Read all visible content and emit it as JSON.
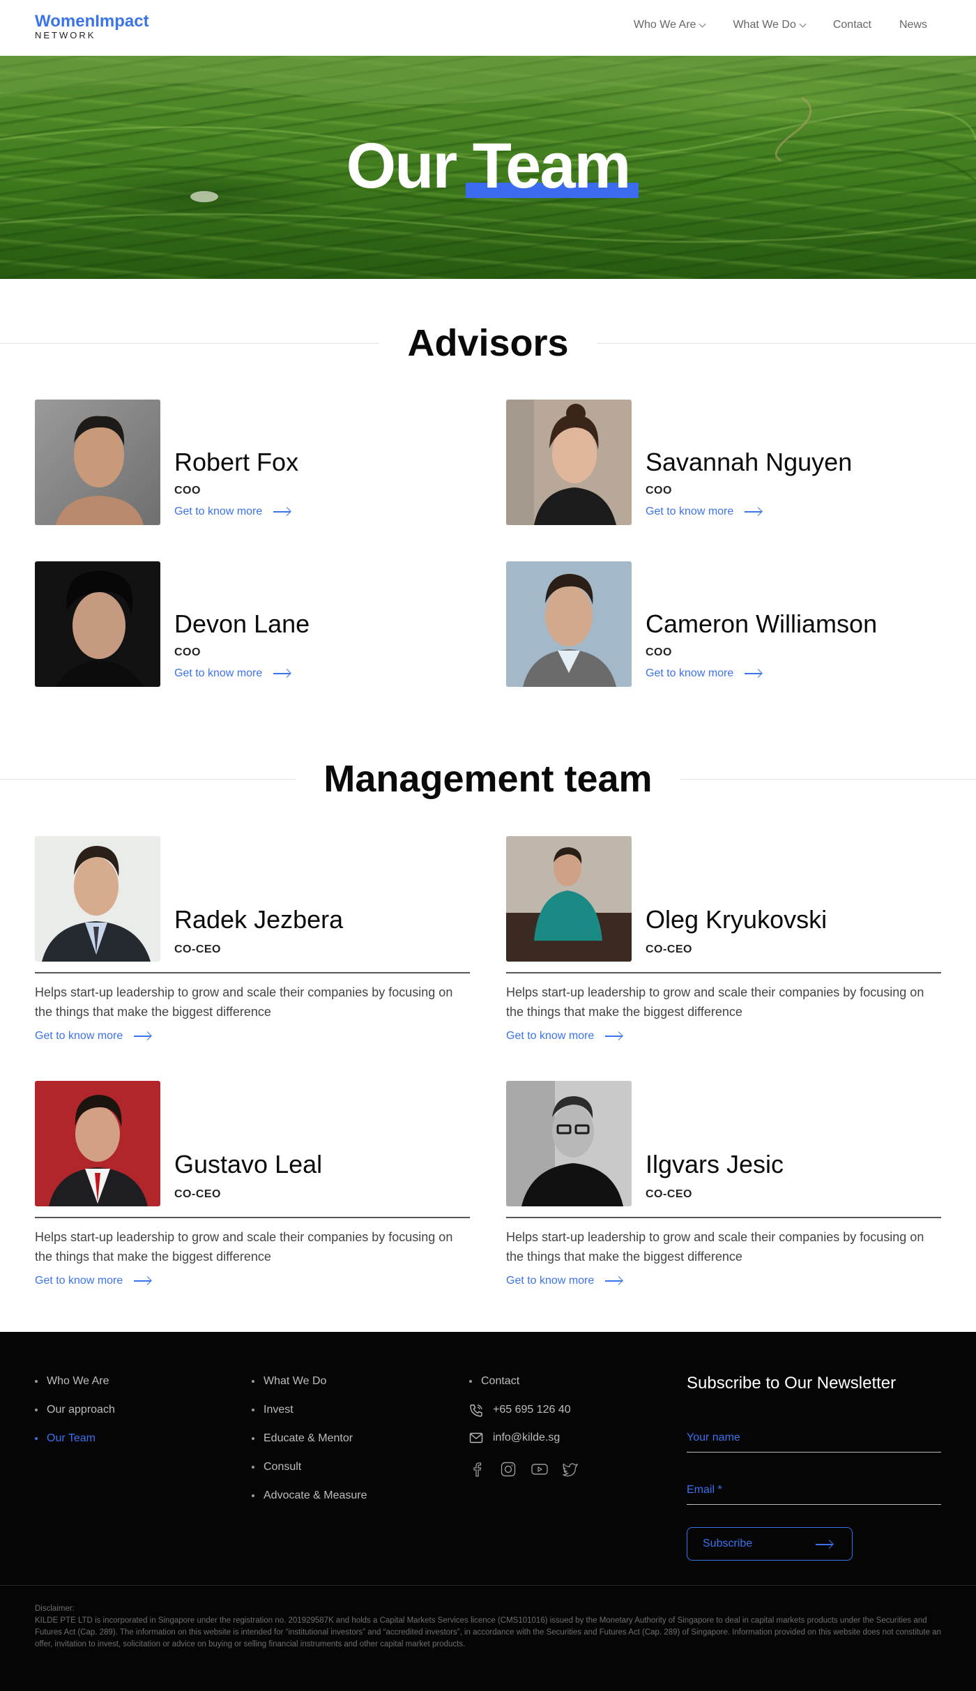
{
  "header": {
    "logo_top": "WomenImpact",
    "logo_bottom": "NETWORK",
    "nav": [
      {
        "label": "Who We Are",
        "dropdown": true
      },
      {
        "label": "What We Do",
        "dropdown": true
      },
      {
        "label": "Contact",
        "dropdown": false
      },
      {
        "label": "News",
        "dropdown": false
      }
    ]
  },
  "hero": {
    "title_part1": "Our",
    "title_part2": "Team"
  },
  "advisors": {
    "title": "Advisors",
    "people": [
      {
        "name": "Robert Fox",
        "role": "COO",
        "link": "Get to know more"
      },
      {
        "name": "Savannah Nguyen",
        "role": "COO",
        "link": "Get to know more"
      },
      {
        "name": "Devon Lane",
        "role": "COO",
        "link": "Get to know more"
      },
      {
        "name": "Cameron Williamson",
        "role": "COO",
        "link": "Get to know more"
      }
    ]
  },
  "management": {
    "title": "Management team",
    "people": [
      {
        "name": "Radek Jezbera",
        "role": "CO-CEO",
        "description": "Helps start-up leadership to grow and scale their companies by focusing on the things that make the biggest difference",
        "link": "Get to know more"
      },
      {
        "name": "Oleg Kryukovski",
        "role": "CO-CEO",
        "description": "Helps start-up leadership to grow and scale their companies by focusing on the things that make the biggest difference",
        "link": "Get to know more"
      },
      {
        "name": "Gustavo Leal",
        "role": "CO-CEO",
        "description": "Helps start-up leadership to grow and scale their companies by focusing on the things that make the biggest difference",
        "link": "Get to know more"
      },
      {
        "name": "Ilgvars Jesic",
        "role": "CO-CEO",
        "description": "Helps start-up leadership to grow and scale their companies by focusing on the things that make the biggest difference",
        "link": "Get to know more"
      }
    ]
  },
  "footer": {
    "col1": [
      "Who We Are",
      "Our approach",
      "Our Team"
    ],
    "col2": [
      "What We Do",
      "Invest",
      "Educate & Mentor",
      "Consult",
      "Advocate & Measure"
    ],
    "contact_label": "Contact",
    "phone": "+65 695 126 40",
    "email": "info@kilde.sg",
    "socials": [
      "facebook-icon",
      "instagram-icon",
      "youtube-icon",
      "twitter-icon"
    ],
    "newsletter": {
      "title": "Subscribe to Our Newsletter",
      "name_placeholder": "Your name",
      "email_placeholder": "Email *",
      "button": "Subscribe"
    },
    "disclaimer_label": "Disclaimer:",
    "disclaimer_text": "KILDE PTE LTD is incorporated in Singapore under the registration no. 201929587K and holds a Capital Markets Services licence (CMS101016) issued by the Monetary Authority of Singapore to deal in capital markets products under the Securities and Futures Act (Cap. 289). The information on this website is intended for “institutional investors” and “accredited investors”, in accordance with the Securities and Futures Act (Cap. 289) of Singapore. Information provided on this website does not constitute an offer, invitation to invest, solicitation or advice on buying or selling financial instruments and other capital market products."
  },
  "colors": {
    "accent": "#3b72ee",
    "footer_bg": "#050505",
    "hero_green": "#3f7a1d"
  }
}
